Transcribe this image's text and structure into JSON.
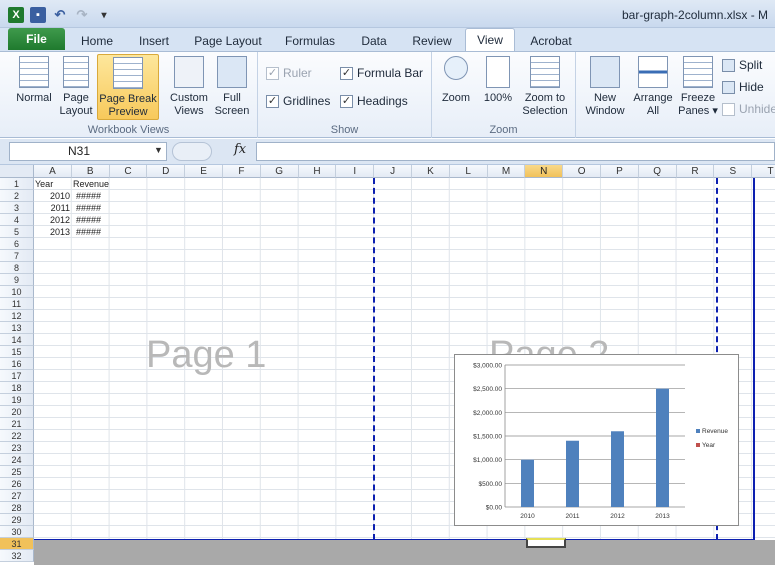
{
  "app": {
    "title": "bar-graph-2column.xlsx - M"
  },
  "qat": {
    "excel_icon": "excel-icon",
    "save_icon": "save-icon",
    "undo_icon": "undo-icon",
    "redo_icon": "redo-icon"
  },
  "tabs": [
    "File",
    "Home",
    "Insert",
    "Page Layout",
    "Formulas",
    "Data",
    "Review",
    "View",
    "Acrobat"
  ],
  "active_tab": "View",
  "ribbon": {
    "workbook_views": {
      "label": "Workbook Views",
      "normal": "Normal",
      "page_layout": "Page Layout",
      "page_break_preview": "Page Break Preview",
      "custom_views": "Custom Views",
      "full_screen": "Full Screen"
    },
    "show": {
      "label": "Show",
      "ruler": "Ruler",
      "gridlines": "Gridlines",
      "formula_bar": "Formula Bar",
      "headings": "Headings"
    },
    "zoom": {
      "label": "Zoom",
      "zoom": "Zoom",
      "zoom100": "100%",
      "zoom_selection": "Zoom to Selection"
    },
    "window": {
      "new_window": "New Window",
      "arrange_all": "Arrange All",
      "freeze_panes": "Freeze Panes",
      "split": "Split",
      "hide": "Hide",
      "unhide": "Unhide"
    }
  },
  "formula_bar": {
    "name_box": "N31",
    "fx": "fx",
    "formula": ""
  },
  "columns": [
    "A",
    "B",
    "C",
    "D",
    "E",
    "F",
    "G",
    "H",
    "I",
    "J",
    "K",
    "L",
    "M",
    "N",
    "O",
    "P",
    "Q",
    "R",
    "S",
    "T"
  ],
  "selected_column": "N",
  "rows": [
    "1",
    "2",
    "3",
    "4",
    "5",
    "6",
    "7",
    "8",
    "9",
    "10",
    "11",
    "12",
    "13",
    "14",
    "15",
    "16",
    "17",
    "18",
    "19",
    "20",
    "21",
    "22",
    "23",
    "24",
    "25",
    "26",
    "27",
    "28",
    "29",
    "30",
    "31",
    "32"
  ],
  "selected_row": "31",
  "cells": {
    "headers": [
      "Year",
      "Revenue"
    ],
    "years": [
      "2010",
      "2011",
      "2012",
      "2013"
    ],
    "revenue_display": [
      "#####",
      "#####",
      "#####",
      "#####"
    ]
  },
  "page_labels": [
    "Page 1",
    "Page 2"
  ],
  "chart_data": {
    "type": "bar",
    "categories": [
      "2010",
      "2011",
      "2012",
      "2013"
    ],
    "series": [
      {
        "name": "Revenue",
        "values": [
          1000,
          1400,
          1600,
          2500
        ],
        "color": "#4f81bd"
      },
      {
        "name": "Year",
        "values": [
          0,
          0,
          0,
          0
        ],
        "color": "#c0504d"
      }
    ],
    "y_ticks": [
      "$0.00",
      "$500.00",
      "$1,000.00",
      "$1,500.00",
      "$2,000.00",
      "$2,500.00",
      "$3,000.00"
    ],
    "ylim": [
      0,
      3000
    ],
    "grid": true,
    "legend": "right"
  }
}
